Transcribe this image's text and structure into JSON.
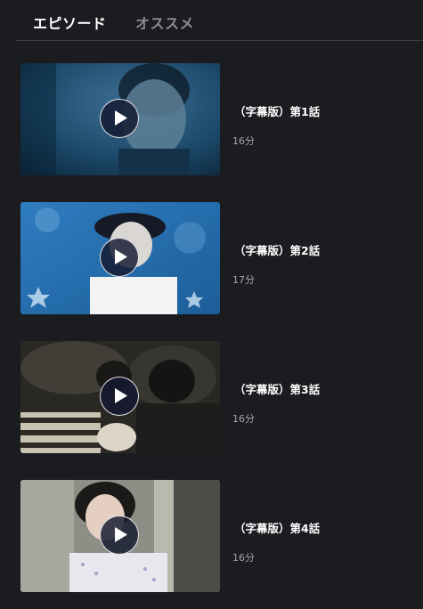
{
  "tabs": [
    {
      "label": "エピソード",
      "active": true
    },
    {
      "label": "オススメ",
      "active": false
    }
  ],
  "episodes": [
    {
      "title": "（字幕版）第1話",
      "duration": "16分",
      "thumbnail": "man-close-up-blue"
    },
    {
      "title": "（字幕版）第2話",
      "duration": "17分",
      "thumbnail": "man-cap-starry-wall"
    },
    {
      "title": "（字幕版）第3話",
      "duration": "16分",
      "thumbnail": "couple-sleeping"
    },
    {
      "title": "（字幕版）第4話",
      "duration": "16分",
      "thumbnail": "woman-smiling-hallway"
    }
  ],
  "icons": {
    "play": "play-icon"
  },
  "colors": {
    "background": "#1b1c20",
    "tab_active": "#ffffff",
    "tab_inactive": "#8b8c92",
    "duration_text": "#a4a5ab",
    "play_button": "#141830"
  }
}
